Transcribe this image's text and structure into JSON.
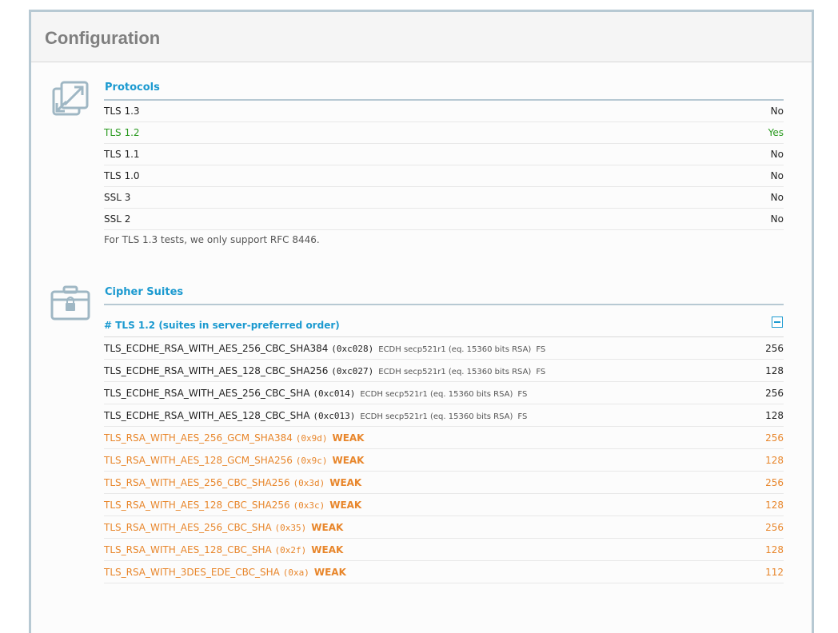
{
  "header": {
    "title": "Configuration"
  },
  "protocols": {
    "title": "Protocols",
    "icon": "arrows-expand-icon",
    "rows": [
      {
        "label": "TLS 1.3",
        "value": "No",
        "ok": false
      },
      {
        "label": "TLS 1.2",
        "value": "Yes",
        "ok": true
      },
      {
        "label": "TLS 1.1",
        "value": "No",
        "ok": false
      },
      {
        "label": "TLS 1.0",
        "value": "No",
        "ok": false
      },
      {
        "label": "SSL 3",
        "value": "No",
        "ok": false
      },
      {
        "label": "SSL 2",
        "value": "No",
        "ok": false
      }
    ],
    "note": "For TLS 1.3 tests, we only support RFC 8446."
  },
  "cipher_suites": {
    "title": "Cipher Suites",
    "icon": "lock-briefcase-icon",
    "group_title": "# TLS 1.2 (suites in server-preferred order)",
    "rows": [
      {
        "name": "TLS_ECDHE_RSA_WITH_AES_256_CBC_SHA384",
        "code": "(0xc028)",
        "detail": "ECDH secp521r1 (eq. 15360 bits RSA)",
        "fs": "FS",
        "weak": "",
        "bits": "256"
      },
      {
        "name": "TLS_ECDHE_RSA_WITH_AES_128_CBC_SHA256",
        "code": "(0xc027)",
        "detail": "ECDH secp521r1 (eq. 15360 bits RSA)",
        "fs": "FS",
        "weak": "",
        "bits": "128"
      },
      {
        "name": "TLS_ECDHE_RSA_WITH_AES_256_CBC_SHA",
        "code": "(0xc014)",
        "detail": "ECDH secp521r1 (eq. 15360 bits RSA)",
        "fs": "FS",
        "weak": "",
        "bits": "256"
      },
      {
        "name": "TLS_ECDHE_RSA_WITH_AES_128_CBC_SHA",
        "code": "(0xc013)",
        "detail": "ECDH secp521r1 (eq. 15360 bits RSA)",
        "fs": "FS",
        "weak": "",
        "bits": "128"
      },
      {
        "name": "TLS_RSA_WITH_AES_256_GCM_SHA384",
        "code": "(0x9d)",
        "detail": "",
        "fs": "",
        "weak": "WEAK",
        "bits": "256"
      },
      {
        "name": "TLS_RSA_WITH_AES_128_GCM_SHA256",
        "code": "(0x9c)",
        "detail": "",
        "fs": "",
        "weak": "WEAK",
        "bits": "128"
      },
      {
        "name": "TLS_RSA_WITH_AES_256_CBC_SHA256",
        "code": "(0x3d)",
        "detail": "",
        "fs": "",
        "weak": "WEAK",
        "bits": "256"
      },
      {
        "name": "TLS_RSA_WITH_AES_128_CBC_SHA256",
        "code": "(0x3c)",
        "detail": "",
        "fs": "",
        "weak": "WEAK",
        "bits": "128"
      },
      {
        "name": "TLS_RSA_WITH_AES_256_CBC_SHA",
        "code": "(0x35)",
        "detail": "",
        "fs": "",
        "weak": "WEAK",
        "bits": "256"
      },
      {
        "name": "TLS_RSA_WITH_AES_128_CBC_SHA",
        "code": "(0x2f)",
        "detail": "",
        "fs": "",
        "weak": "WEAK",
        "bits": "128"
      },
      {
        "name": "TLS_RSA_WITH_3DES_EDE_CBC_SHA",
        "code": "(0xa)",
        "detail": "",
        "fs": "",
        "weak": "WEAK",
        "bits": "112"
      }
    ]
  },
  "colors": {
    "accent": "#1c9ad0",
    "ok": "#2a9a1f",
    "weak": "#e8862b",
    "border": "#b7c9d3"
  }
}
